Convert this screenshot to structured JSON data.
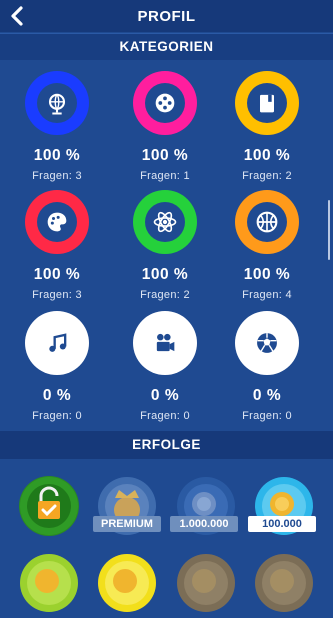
{
  "header": {
    "title": "PROFIL"
  },
  "sections": {
    "categories": "KATEGORIEN",
    "achievements": "ERFOLGE"
  },
  "categories": [
    {
      "icon": "globe-icon",
      "color": "#1a3cff",
      "percent": "100 %",
      "questions": "Fragen: 3"
    },
    {
      "icon": "film-reel-icon",
      "color": "#ff1e9e",
      "percent": "100 %",
      "questions": "Fragen: 1"
    },
    {
      "icon": "book-icon",
      "color": "#ffbf00",
      "percent": "100 %",
      "questions": "Fragen: 2"
    },
    {
      "icon": "palette-icon",
      "color": "#ff2946",
      "percent": "100 %",
      "questions": "Fragen: 3"
    },
    {
      "icon": "atom-icon",
      "color": "#25d13b",
      "percent": "100 %",
      "questions": "Fragen: 2"
    },
    {
      "icon": "basketball-icon",
      "color": "#ff9a1a",
      "percent": "100 %",
      "questions": "Fragen: 4"
    },
    {
      "icon": "music-note-icon",
      "color": "#ffffff",
      "percent": "0 %",
      "questions": "Fragen: 0"
    },
    {
      "icon": "movie-camera-icon",
      "color": "#ffffff",
      "percent": "0 %",
      "questions": "Fragen: 0"
    },
    {
      "icon": "soccer-ball-icon",
      "color": "#ffffff",
      "percent": "0 %",
      "questions": "Fragen: 0"
    }
  ],
  "achievements": [
    {
      "icon": "unlock-check-icon",
      "label": ""
    },
    {
      "icon": "crown-coin-icon",
      "label": "PREMIUM"
    },
    {
      "icon": "coin-stack-icon",
      "label": "1.000.000"
    },
    {
      "icon": "coin-stack-icon",
      "label": "100.000"
    }
  ]
}
